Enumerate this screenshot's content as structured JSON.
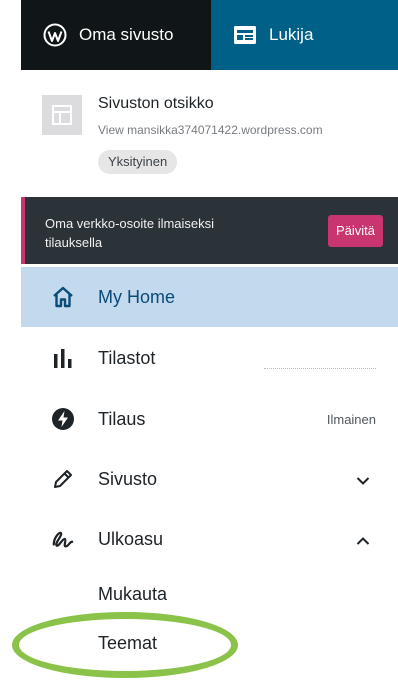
{
  "top_tabs": {
    "site_label": "Oma sivusto",
    "reader_label": "Lukija"
  },
  "site": {
    "title": "Sivuston otsikko",
    "url": "View mansikka374071422.wordpress.com",
    "badge": "Yksityinen"
  },
  "promo": {
    "text": "Oma verkko-osoite ilmaiseksi tilauksella",
    "button": "Päivitä"
  },
  "menu": {
    "home": "My Home",
    "stats": "Tilastot",
    "plan": "Tilaus",
    "plan_badge": "Ilmainen",
    "site": "Sivusto",
    "appearance": "Ulkoasu",
    "customize": "Mukauta",
    "themes": "Teemat"
  },
  "colors": {
    "topbar_dark": "#101517",
    "topbar_blue": "#006088",
    "active_bg": "#c3d9ee",
    "promo_bg": "#2c3338",
    "accent": "#c9356e",
    "highlight_circle": "#8bc34a"
  }
}
